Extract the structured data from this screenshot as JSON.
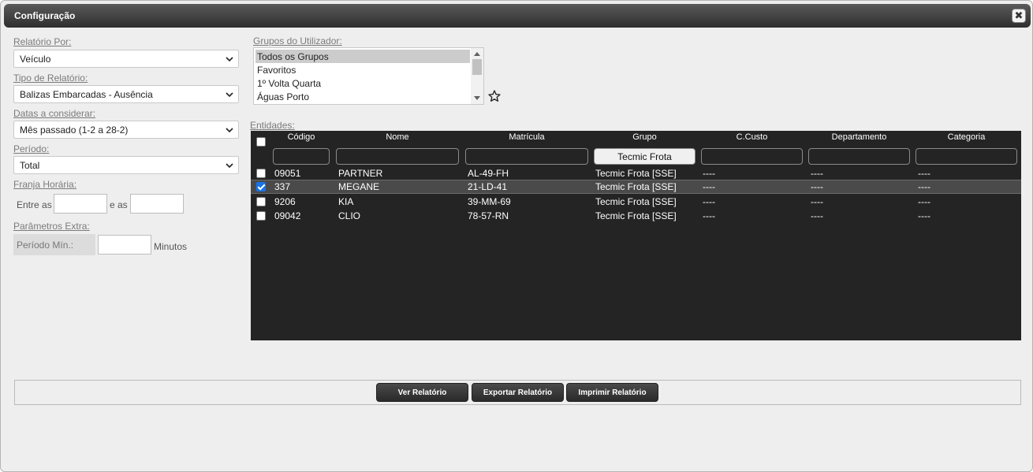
{
  "dialog": {
    "title": "Configuração",
    "close_glyph": "✖"
  },
  "form": {
    "relatorio_por": {
      "label": "Relatório Por:",
      "value": "Veículo"
    },
    "tipo_relatorio": {
      "label": "Tipo de Relatório:",
      "value": "Balizas Embarcadas - Ausência"
    },
    "datas": {
      "label": "Datas a considerar:",
      "value": "Mês passado (1-2 a 28-2)"
    },
    "periodo": {
      "label": "Período:",
      "value": "Total"
    },
    "franja": {
      "label": "Franja Horária:",
      "entre_as": "Entre as",
      "e_as": "e as"
    },
    "parametros": {
      "label": "Parâmetros Extra:",
      "periodo_min": "Período Mín.:",
      "minutos": "Minutos"
    }
  },
  "grupos": {
    "label": "Grupos do Utilizador:",
    "items": [
      "Todos os Grupos",
      "Favoritos",
      "1º Volta Quarta",
      "Águas Porto"
    ],
    "selected": "Todos os Grupos",
    "favorite_icon": "star-outline-icon"
  },
  "entidades": {
    "label": "Entidades:",
    "columns": [
      "Código",
      "Nome",
      "Matrícula",
      "Grupo",
      "C.Custo",
      "Departamento",
      "Categoria"
    ],
    "filters": [
      "",
      "",
      "",
      "Tecmic Frota",
      "",
      "",
      ""
    ],
    "rows": [
      {
        "checked": false,
        "codigo": "09051",
        "nome": "PARTNER",
        "matricula": "AL-49-FH",
        "grupo": "Tecmic Frota [SSE]",
        "ccusto": "----",
        "departamento": "----",
        "categoria": "----"
      },
      {
        "checked": true,
        "codigo": "337",
        "nome": "MEGANE",
        "matricula": "21-LD-41",
        "grupo": "Tecmic Frota [SSE]",
        "ccusto": "----",
        "departamento": "----",
        "categoria": "----"
      },
      {
        "checked": false,
        "codigo": "9206",
        "nome": "KIA",
        "matricula": "39-MM-69",
        "grupo": "Tecmic Frota [SSE]",
        "ccusto": "----",
        "departamento": "----",
        "categoria": "----"
      },
      {
        "checked": false,
        "codigo": "09042",
        "nome": "CLIO",
        "matricula": "78-57-RN",
        "grupo": "Tecmic Frota [SSE]",
        "ccusto": "----",
        "departamento": "----",
        "categoria": "----"
      }
    ]
  },
  "actions": {
    "ver": "Ver Relatório",
    "exportar": "Exportar Relatório",
    "imprimir": "Imprimir Relatório"
  },
  "colors": {
    "grid_bg": "#242424",
    "checkbox_checked": "#1a73e8",
    "titlebar": "#3a3a3a"
  }
}
